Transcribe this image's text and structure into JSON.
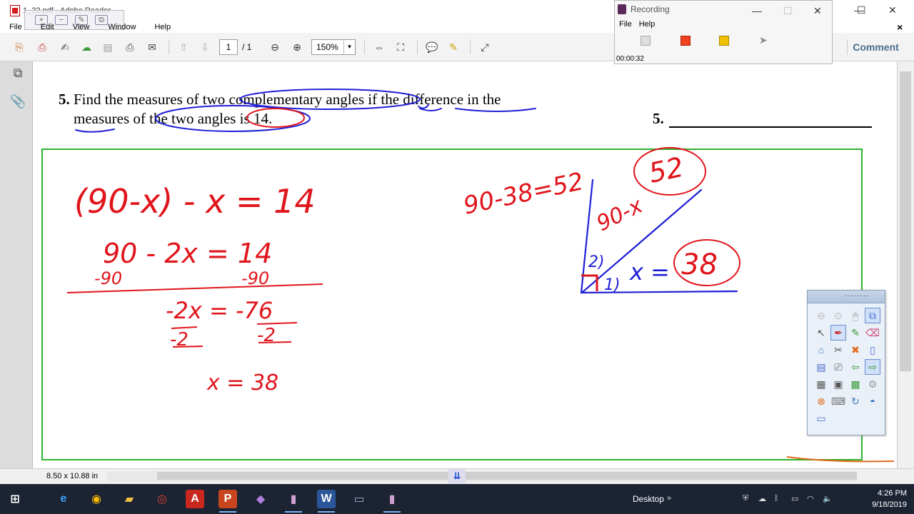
{
  "window": {
    "title": "1_22.pdf - Adobe Reader",
    "menu": [
      "File",
      "Edit",
      "View",
      "Window",
      "Help"
    ]
  },
  "toolbar": {
    "page_current": "1",
    "page_total": "/ 1",
    "zoom": "150%",
    "comment_label": "Comment",
    "close_label": "×",
    "icons": [
      "create-pdf-icon",
      "convert-icon",
      "sign-icon",
      "upload-icon",
      "save-icon",
      "print-icon",
      "email-icon",
      "prev-page-icon",
      "next-page-icon",
      "zoom-out-icon",
      "zoom-in-icon",
      "fit-width-icon",
      "fit-page-icon",
      "sticky-note-icon",
      "highlight-icon",
      "fullscreen-icon"
    ]
  },
  "document": {
    "problem_number": "5.",
    "problem_line1": "Find the measures of two complementary angles if the difference in the",
    "problem_line2": "measures of the two angles is 14.",
    "answer_label": "5.",
    "page_size": "8.50 x 10.88 in"
  },
  "handwriting": {
    "eq1": "(90-x) - x = 14",
    "eq2": "90 - 2x = 14",
    "eq2_sub_left": "-90",
    "eq2_sub_right": "-90",
    "eq3": "-2x = -76",
    "eq3_div_left": "-2",
    "eq3_div_right": "-2",
    "eq4": "x = 38",
    "side_calc": "90-38=52",
    "angle1_label": "x =",
    "angle1_value": "38",
    "angle2_label": "90-x",
    "angle2_value": "52",
    "mark1": "1)",
    "mark2": "2)"
  },
  "recorder": {
    "title": "Recording",
    "menu": [
      "File",
      "Help"
    ],
    "time": "00:00:32"
  },
  "palette": {
    "title_dots": "········"
  },
  "taskbar": {
    "desktop_label": "Desktop",
    "time": "4:26 PM",
    "date": "9/18/2019"
  },
  "colors": {
    "ink_red": "#e0151c",
    "ink_blue": "#1f1fd6",
    "answer_box": "#2db22d",
    "taskbar_bg": "#1c2434",
    "comment_text": "#4b6c8c"
  }
}
